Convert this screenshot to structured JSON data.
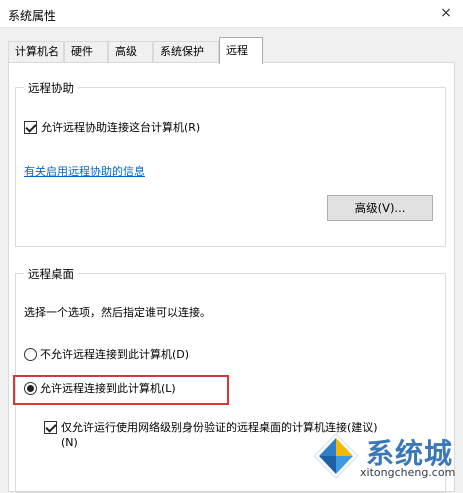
{
  "window": {
    "title": "系统属性",
    "close_glyph": "×"
  },
  "tabs": [
    {
      "label": "计算机名"
    },
    {
      "label": "硬件"
    },
    {
      "label": "高级"
    },
    {
      "label": "系统保护"
    },
    {
      "label": "远程",
      "active": true
    }
  ],
  "remote_assistance": {
    "legend": "远程协助",
    "allow_checkbox": {
      "label": "允许远程协助连接这台计算机(R)",
      "checked": true
    },
    "info_link": "有关启用远程协助的信息",
    "advanced_button": "高级(V)..."
  },
  "remote_desktop": {
    "legend": "远程桌面",
    "instruction": "选择一个选项，然后指定谁可以连接。",
    "options": [
      {
        "label": "不允许远程连接到此计算机(D)",
        "selected": false
      },
      {
        "label": "允许远程连接到此计算机(L)",
        "selected": true
      }
    ],
    "nla_checkbox": {
      "label_line1": "仅允许运行使用网络级别身份验证的远程桌面的计算机连接(建议)",
      "label_line2": "(N)",
      "checked": true
    }
  },
  "watermark": {
    "brand": "系统城",
    "url": "xitongcheng.com"
  },
  "colors": {
    "link": "#0066cc",
    "highlight": "#d9383a",
    "brand": "#3b78b8"
  }
}
